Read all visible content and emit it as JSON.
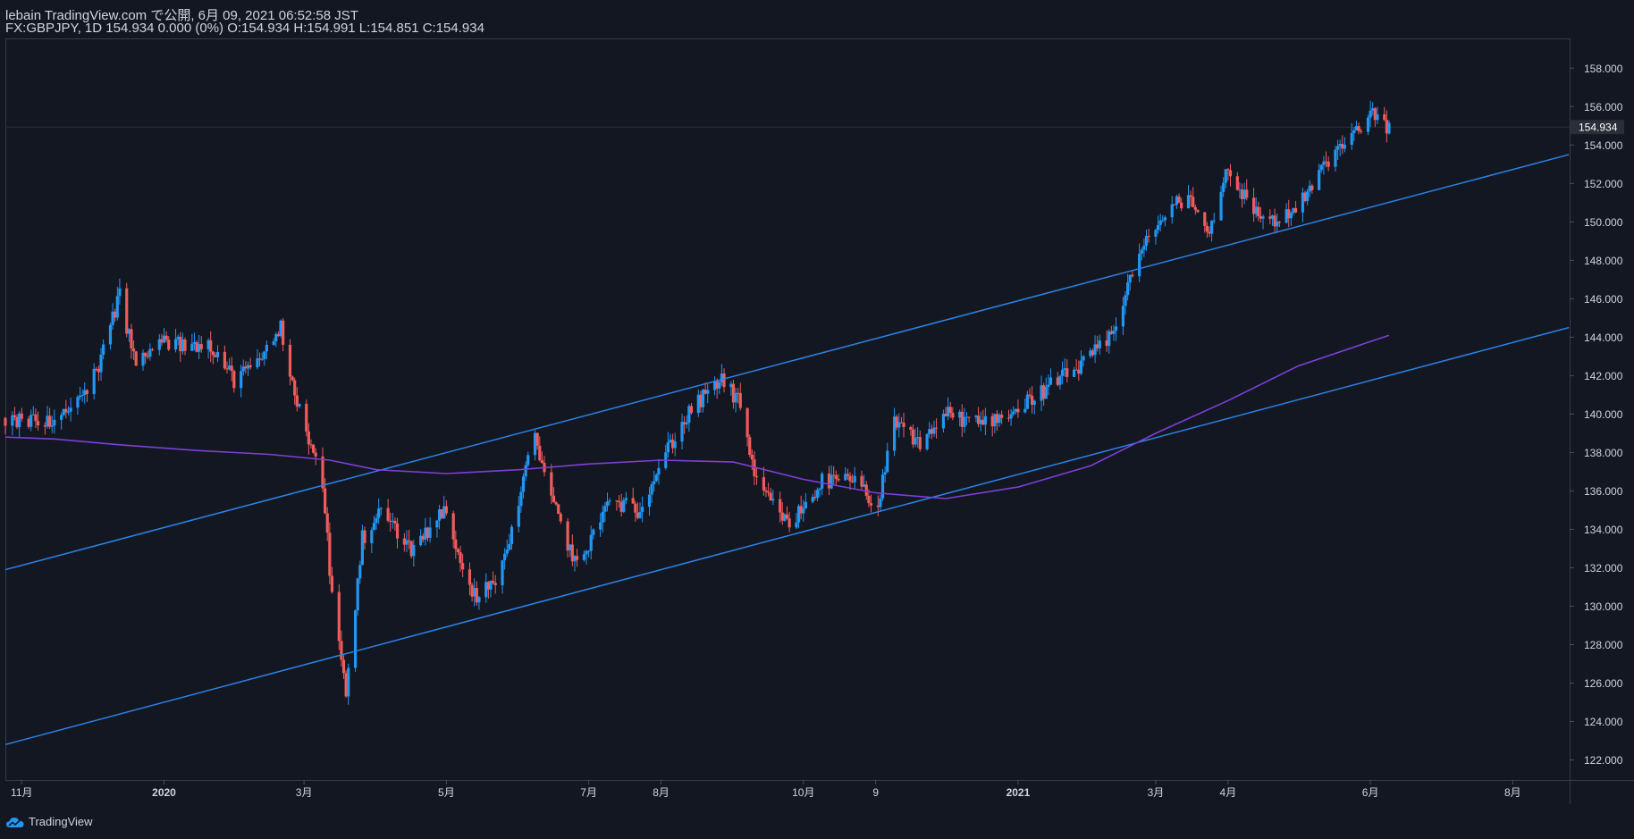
{
  "header": {
    "published": "lebain TradingView.com で公開, 6月 09, 2021 06:52:58 JST",
    "quote": "FX:GBPJPY, 1D 154.934 0.000 (0%) O:154.934 H:154.991 L:154.851 C:154.934"
  },
  "footer": {
    "brand": "TradingView"
  },
  "colors": {
    "background": "#131722",
    "up_candle": "#2196f3",
    "down_candle": "#f05b5b",
    "channel_line": "#2a83e6",
    "moving_average": "#7e3fd6",
    "price_label_bg": "#2a2e39",
    "text": "#d1d4dc"
  },
  "chart_data": {
    "type": "candlestick",
    "symbol": "FX:GBPJPY",
    "interval": "1D",
    "ylim": [
      121,
      159.5
    ],
    "y_ticks": [
      "122.000",
      "124.000",
      "126.000",
      "128.000",
      "130.000",
      "132.000",
      "134.000",
      "136.000",
      "138.000",
      "140.000",
      "142.000",
      "144.000",
      "146.000",
      "148.000",
      "150.000",
      "152.000",
      "154.000",
      "156.000",
      "158.000"
    ],
    "last_price": "154.934",
    "x_labels": [
      "11月",
      "2020",
      "3月",
      "5月",
      "7月",
      "8月",
      "10月",
      "9",
      "2021",
      "3月",
      "4月",
      "6月",
      "8月"
    ],
    "price_path": [
      [
        "2019-10-25",
        139.8
      ],
      [
        "2019-11-01",
        139.6
      ],
      [
        "2019-11-15",
        139.5
      ],
      [
        "2019-11-25",
        140.6
      ],
      [
        "2019-12-04",
        142.5
      ],
      [
        "2019-12-13",
        146.2
      ],
      [
        "2019-12-20",
        142.5
      ],
      [
        "2019-12-31",
        143.8
      ],
      [
        "2020-01-10",
        143.5
      ],
      [
        "2020-01-20",
        143.8
      ],
      [
        "2020-01-31",
        141.8
      ],
      [
        "2020-02-10",
        142.6
      ],
      [
        "2020-02-20",
        144.5
      ],
      [
        "2020-02-26",
        141.2
      ],
      [
        "2020-03-04",
        138.1
      ],
      [
        "2020-03-09",
        136.5
      ],
      [
        "2020-03-13",
        130.5
      ],
      [
        "2020-03-19",
        125.5
      ],
      [
        "2020-03-26",
        133.5
      ],
      [
        "2020-04-03",
        135.0
      ],
      [
        "2020-04-16",
        133.0
      ],
      [
        "2020-04-30",
        135.0
      ],
      [
        "2020-05-14",
        130.2
      ],
      [
        "2020-05-25",
        132.0
      ],
      [
        "2020-06-08",
        139.0
      ],
      [
        "2020-06-15",
        135.5
      ],
      [
        "2020-06-26",
        132.0
      ],
      [
        "2020-07-10",
        135.5
      ],
      [
        "2020-07-22",
        135.0
      ],
      [
        "2020-08-03",
        138.0
      ],
      [
        "2020-08-14",
        140.2
      ],
      [
        "2020-08-27",
        141.8
      ],
      [
        "2020-09-04",
        140.5
      ],
      [
        "2020-09-11",
        136.3
      ],
      [
        "2020-09-25",
        134.2
      ],
      [
        "2020-10-09",
        136.5
      ],
      [
        "2020-10-23",
        136.5
      ],
      [
        "2020-11-02",
        135.2
      ],
      [
        "2020-11-09",
        139.5
      ],
      [
        "2020-11-20",
        138.5
      ],
      [
        "2020-12-01",
        140.0
      ],
      [
        "2020-12-15",
        139.5
      ],
      [
        "2020-12-31",
        140.2
      ],
      [
        "2021-01-15",
        141.5
      ],
      [
        "2021-01-29",
        142.6
      ],
      [
        "2021-02-10",
        144.0
      ],
      [
        "2021-02-19",
        147.5
      ],
      [
        "2021-03-01",
        149.8
      ],
      [
        "2021-03-15",
        151.5
      ],
      [
        "2021-03-23",
        149.3
      ],
      [
        "2021-04-01",
        152.8
      ],
      [
        "2021-04-12",
        150.5
      ],
      [
        "2021-04-22",
        150.0
      ],
      [
        "2021-05-04",
        151.2
      ],
      [
        "2021-05-14",
        153.3
      ],
      [
        "2021-05-26",
        154.6
      ],
      [
        "2021-06-02",
        155.8
      ],
      [
        "2021-06-09",
        154.9
      ]
    ],
    "ma": [
      [
        "2019-10-25",
        138.8
      ],
      [
        "2019-11-15",
        138.7
      ],
      [
        "2019-12-13",
        138.4
      ],
      [
        "2020-01-15",
        138.1
      ],
      [
        "2020-02-15",
        137.9
      ],
      [
        "2020-03-12",
        137.6
      ],
      [
        "2020-04-01",
        137.1
      ],
      [
        "2020-05-01",
        136.9
      ],
      [
        "2020-06-01",
        137.1
      ],
      [
        "2020-07-01",
        137.4
      ],
      [
        "2020-08-01",
        137.6
      ],
      [
        "2020-09-01",
        137.5
      ],
      [
        "2020-10-01",
        136.6
      ],
      [
        "2020-11-01",
        135.9
      ],
      [
        "2020-12-01",
        135.6
      ],
      [
        "2021-01-01",
        136.2
      ],
      [
        "2021-02-01",
        137.3
      ],
      [
        "2021-03-01",
        139.0
      ],
      [
        "2021-04-01",
        140.7
      ],
      [
        "2021-05-01",
        142.5
      ],
      [
        "2021-06-09",
        144.1
      ]
    ],
    "trendlines": [
      {
        "from": [
          "2019-10-25",
          131.9
        ],
        "to": [
          "2021-08-25",
          153.5
        ]
      },
      {
        "from": [
          "2019-10-25",
          122.8
        ],
        "to": [
          "2021-08-25",
          144.5
        ]
      }
    ]
  }
}
